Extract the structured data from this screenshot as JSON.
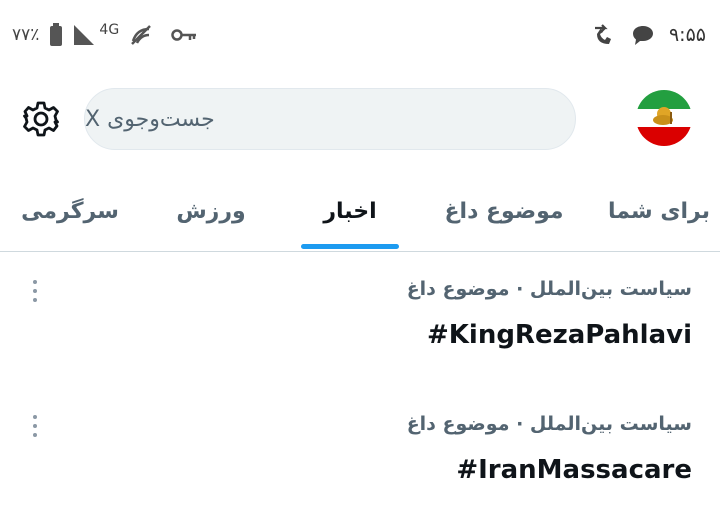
{
  "status_bar": {
    "time": "۹:۵۵",
    "battery_percent": "۷۷٪",
    "network": "4G",
    "icons_left": [
      "battery-icon",
      "signal-icon",
      "data-saver-icon",
      "vpn-key-icon"
    ],
    "icons_right": [
      "call-forward-icon",
      "message-bubble-icon"
    ]
  },
  "header": {
    "avatar": "profile-avatar",
    "search_placeholder": "جست‌وجوی X",
    "settings_icon": "gear-icon"
  },
  "tabs": [
    {
      "label": "برای شما",
      "active": false
    },
    {
      "label": "موضوع داغ",
      "active": false
    },
    {
      "label": "اخبار",
      "active": true
    },
    {
      "label": "ورزش",
      "active": false
    },
    {
      "label": "سرگرمی",
      "active": false
    }
  ],
  "trends": [
    {
      "meta": "سیاست بین‌الملل · موضوع داغ",
      "title": "#KingRezaPahlavi"
    },
    {
      "meta": "سیاست بین‌الملل · موضوع داغ",
      "title": "#IranMassacare"
    }
  ],
  "colors": {
    "accent": "#1d9bf0",
    "text_primary": "#0f1419",
    "text_secondary": "#536471",
    "search_bg": "#eff3f4"
  }
}
